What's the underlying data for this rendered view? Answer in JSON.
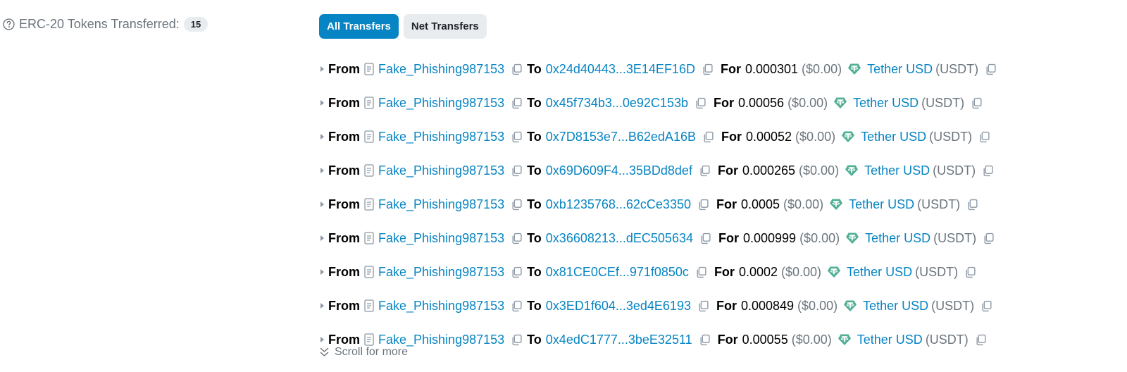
{
  "summary": {
    "label": "ERC-20 Tokens Transferred:",
    "count": "15"
  },
  "tabs": [
    {
      "label": "All Transfers",
      "active": true
    },
    {
      "label": "Net Transfers",
      "active": false
    }
  ],
  "labels": {
    "from": "From",
    "to": "To",
    "for": "For",
    "scroll_more": "Scroll for more"
  },
  "transfers": [
    {
      "from": "Fake_Phishing987153",
      "to": "0x24d40443...3E14EF16D",
      "amount": "0.000301",
      "usd": "($0.00)",
      "token": "Tether USD",
      "symbol": "(USDT)"
    },
    {
      "from": "Fake_Phishing987153",
      "to": "0x45f734b3...0e92C153b",
      "amount": "0.00056",
      "usd": "($0.00)",
      "token": "Tether USD",
      "symbol": "(USDT)"
    },
    {
      "from": "Fake_Phishing987153",
      "to": "0x7D8153e7...B62edA16B",
      "amount": "0.00052",
      "usd": "($0.00)",
      "token": "Tether USD",
      "symbol": "(USDT)"
    },
    {
      "from": "Fake_Phishing987153",
      "to": "0x69D609F4...35BDd8def",
      "amount": "0.000265",
      "usd": "($0.00)",
      "token": "Tether USD",
      "symbol": "(USDT)"
    },
    {
      "from": "Fake_Phishing987153",
      "to": "0xb1235768...62cCe3350",
      "amount": "0.0005",
      "usd": "($0.00)",
      "token": "Tether USD",
      "symbol": "(USDT)"
    },
    {
      "from": "Fake_Phishing987153",
      "to": "0x36608213...dEC505634",
      "amount": "0.000999",
      "usd": "($0.00)",
      "token": "Tether USD",
      "symbol": "(USDT)"
    },
    {
      "from": "Fake_Phishing987153",
      "to": "0x81CE0CEf...971f0850c",
      "amount": "0.0002",
      "usd": "($0.00)",
      "token": "Tether USD",
      "symbol": "(USDT)"
    },
    {
      "from": "Fake_Phishing987153",
      "to": "0x3ED1f604...3ed4E6193",
      "amount": "0.000849",
      "usd": "($0.00)",
      "token": "Tether USD",
      "symbol": "(USDT)"
    },
    {
      "from": "Fake_Phishing987153",
      "to": "0x4edC1777...3beE32511",
      "amount": "0.00055",
      "usd": "($0.00)",
      "token": "Tether USD",
      "symbol": "(USDT)"
    }
  ],
  "colors": {
    "accent": "#0784c3",
    "tether": "#50af95",
    "muted": "#6c757d"
  }
}
